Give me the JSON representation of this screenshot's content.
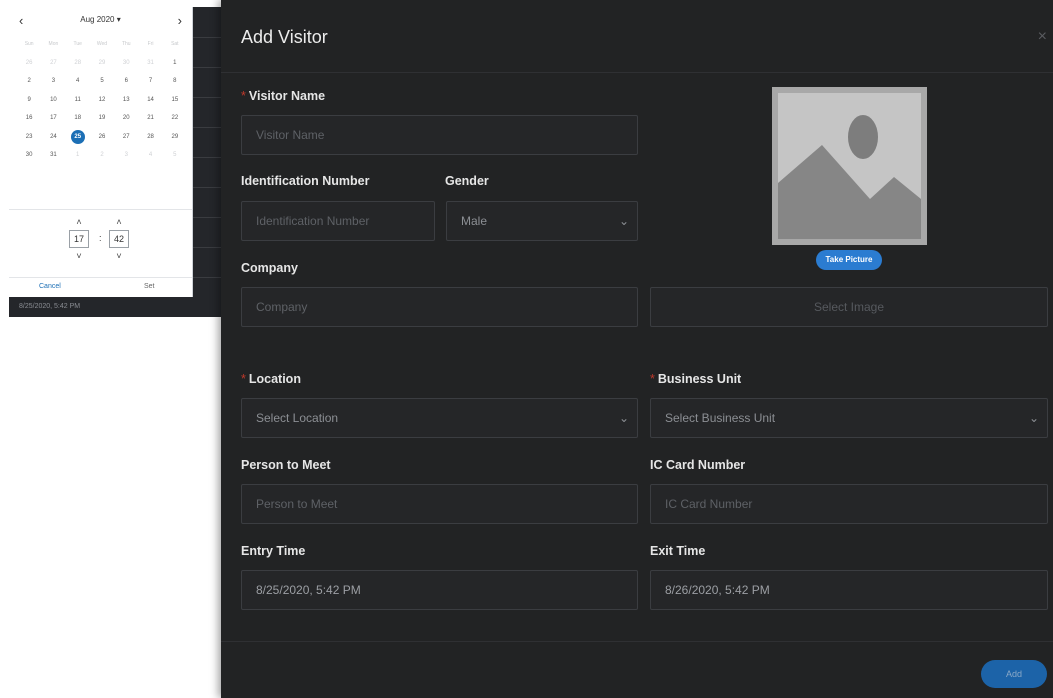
{
  "datepicker": {
    "prev_icon": "‹",
    "next_icon": "›",
    "month_label": "Aug 2020 ▾",
    "weekdays": [
      "Sun",
      "Mon",
      "Tue",
      "Wed",
      "Thu",
      "Fri",
      "Sat"
    ],
    "weeks": [
      [
        "26",
        "27",
        "28",
        "29",
        "30",
        "31",
        "1"
      ],
      [
        "2",
        "3",
        "4",
        "5",
        "6",
        "7",
        "8"
      ],
      [
        "9",
        "10",
        "11",
        "12",
        "13",
        "14",
        "15"
      ],
      [
        "16",
        "17",
        "18",
        "19",
        "20",
        "21",
        "22"
      ],
      [
        "23",
        "24",
        "25",
        "26",
        "27",
        "28",
        "29"
      ],
      [
        "30",
        "31",
        "1",
        "2",
        "3",
        "4",
        "5"
      ]
    ],
    "selected_day": "25",
    "hour_value": "17",
    "minute_value": "42",
    "time_colon": ":",
    "up_icon": "˄",
    "down_icon": "˅",
    "cancel_label": "Cancel",
    "set_label": "Set",
    "footer_text": "8/25/2020, 5:42 PM"
  },
  "modal": {
    "title": "Add Visitor",
    "close_icon": "×",
    "required_mark": "*",
    "visitor_name": {
      "label": "Visitor Name",
      "placeholder": "Visitor Name"
    },
    "identification_number": {
      "label": "Identification Number",
      "placeholder": "Identification Number"
    },
    "gender": {
      "label": "Gender",
      "value": "Male"
    },
    "company": {
      "label": "Company",
      "placeholder": "Company"
    },
    "take_picture_label": "Take Picture",
    "select_image_label": "Select Image",
    "location": {
      "label": "Location",
      "placeholder": "Select Location"
    },
    "business_unit": {
      "label": "Business Unit",
      "placeholder": "Select Business Unit"
    },
    "person_to_meet": {
      "label": "Person to Meet",
      "placeholder": "Person to Meet"
    },
    "ic_card_number": {
      "label": "IC Card Number",
      "placeholder": "IC Card Number"
    },
    "entry_time": {
      "label": "Entry Time",
      "value": "8/25/2020, 5:42 PM"
    },
    "exit_time": {
      "label": "Exit Time",
      "value": "8/26/2020, 5:42 PM"
    },
    "chevron_icon": "⌄",
    "add_label": "Add"
  }
}
